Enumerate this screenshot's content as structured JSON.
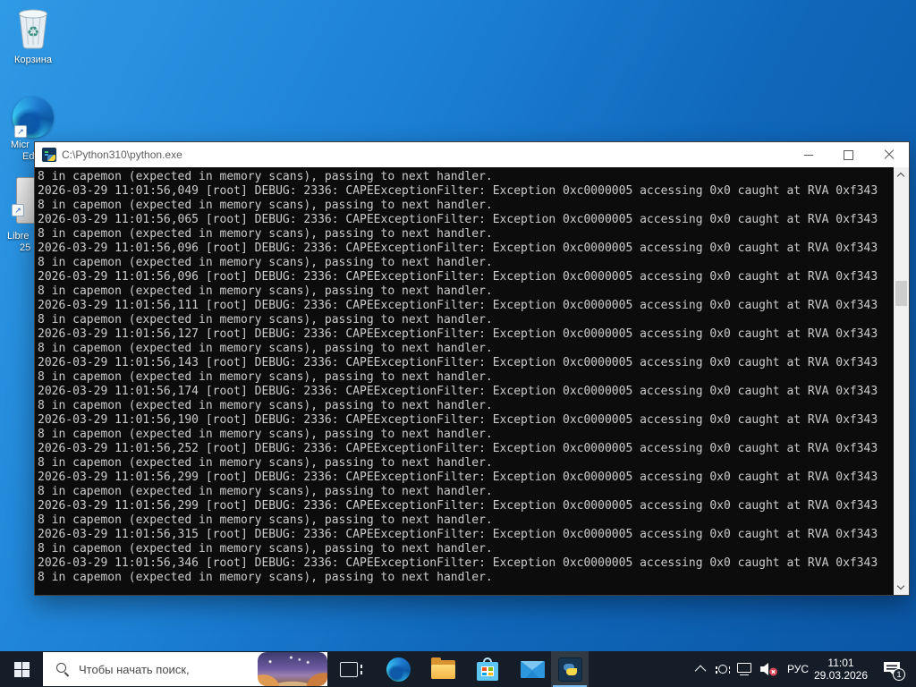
{
  "icons": {
    "shortcut_arrow": "↗",
    "recycle_symbol": "♻"
  },
  "desktop": {
    "icons": [
      {
        "id": "recycle-bin",
        "label": "Корзина"
      },
      {
        "id": "microsoft-edge-shortcut",
        "label_lines": [
          "Micr",
          "Ed"
        ]
      },
      {
        "id": "libreoffice-shortcut",
        "label_lines": [
          "Libre",
          "25"
        ]
      }
    ]
  },
  "console_window": {
    "title": "C:\\Python310\\python.exe",
    "lines": [
      "8 in capemon (expected in memory scans), passing to next handler.",
      "2026-03-29 11:01:56,049 [root] DEBUG: 2336: CAPEExceptionFilter: Exception 0xc0000005 accessing 0x0 caught at RVA 0xf343",
      "8 in capemon (expected in memory scans), passing to next handler.",
      "2026-03-29 11:01:56,065 [root] DEBUG: 2336: CAPEExceptionFilter: Exception 0xc0000005 accessing 0x0 caught at RVA 0xf343",
      "8 in capemon (expected in memory scans), passing to next handler.",
      "2026-03-29 11:01:56,096 [root] DEBUG: 2336: CAPEExceptionFilter: Exception 0xc0000005 accessing 0x0 caught at RVA 0xf343",
      "8 in capemon (expected in memory scans), passing to next handler.",
      "2026-03-29 11:01:56,096 [root] DEBUG: 2336: CAPEExceptionFilter: Exception 0xc0000005 accessing 0x0 caught at RVA 0xf343",
      "8 in capemon (expected in memory scans), passing to next handler.",
      "2026-03-29 11:01:56,111 [root] DEBUG: 2336: CAPEExceptionFilter: Exception 0xc0000005 accessing 0x0 caught at RVA 0xf343",
      "8 in capemon (expected in memory scans), passing to next handler.",
      "2026-03-29 11:01:56,127 [root] DEBUG: 2336: CAPEExceptionFilter: Exception 0xc0000005 accessing 0x0 caught at RVA 0xf343",
      "8 in capemon (expected in memory scans), passing to next handler.",
      "2026-03-29 11:01:56,143 [root] DEBUG: 2336: CAPEExceptionFilter: Exception 0xc0000005 accessing 0x0 caught at RVA 0xf343",
      "8 in capemon (expected in memory scans), passing to next handler.",
      "2026-03-29 11:01:56,174 [root] DEBUG: 2336: CAPEExceptionFilter: Exception 0xc0000005 accessing 0x0 caught at RVA 0xf343",
      "8 in capemon (expected in memory scans), passing to next handler.",
      "2026-03-29 11:01:56,190 [root] DEBUG: 2336: CAPEExceptionFilter: Exception 0xc0000005 accessing 0x0 caught at RVA 0xf343",
      "8 in capemon (expected in memory scans), passing to next handler.",
      "2026-03-29 11:01:56,252 [root] DEBUG: 2336: CAPEExceptionFilter: Exception 0xc0000005 accessing 0x0 caught at RVA 0xf343",
      "8 in capemon (expected in memory scans), passing to next handler.",
      "2026-03-29 11:01:56,299 [root] DEBUG: 2336: CAPEExceptionFilter: Exception 0xc0000005 accessing 0x0 caught at RVA 0xf343",
      "8 in capemon (expected in memory scans), passing to next handler.",
      "2026-03-29 11:01:56,299 [root] DEBUG: 2336: CAPEExceptionFilter: Exception 0xc0000005 accessing 0x0 caught at RVA 0xf343",
      "8 in capemon (expected in memory scans), passing to next handler.",
      "2026-03-29 11:01:56,315 [root] DEBUG: 2336: CAPEExceptionFilter: Exception 0xc0000005 accessing 0x0 caught at RVA 0xf343",
      "8 in capemon (expected in memory scans), passing to next handler.",
      "2026-03-29 11:01:56,346 [root] DEBUG: 2336: CAPEExceptionFilter: Exception 0xc0000005 accessing 0x0 caught at RVA 0xf343",
      "8 in capemon (expected in memory scans), passing to next handler."
    ]
  },
  "taskbar": {
    "search_placeholder": "Чтобы начать поиск,",
    "app_icons": [
      "task-view",
      "microsoft-edge",
      "file-explorer",
      "microsoft-store",
      "mail",
      "python-console"
    ],
    "active_app": "python-console",
    "tray": {
      "language": "РУС",
      "time": "11:01",
      "date": "29.03.2026",
      "notification_count": "1"
    }
  },
  "colors": {
    "taskbar_bg": "#151e28",
    "console_bg": "#0c0c0c",
    "console_text": "#cccccc",
    "desktop_blue": "#1b7ed2",
    "active_underline": "#76b9ed"
  }
}
